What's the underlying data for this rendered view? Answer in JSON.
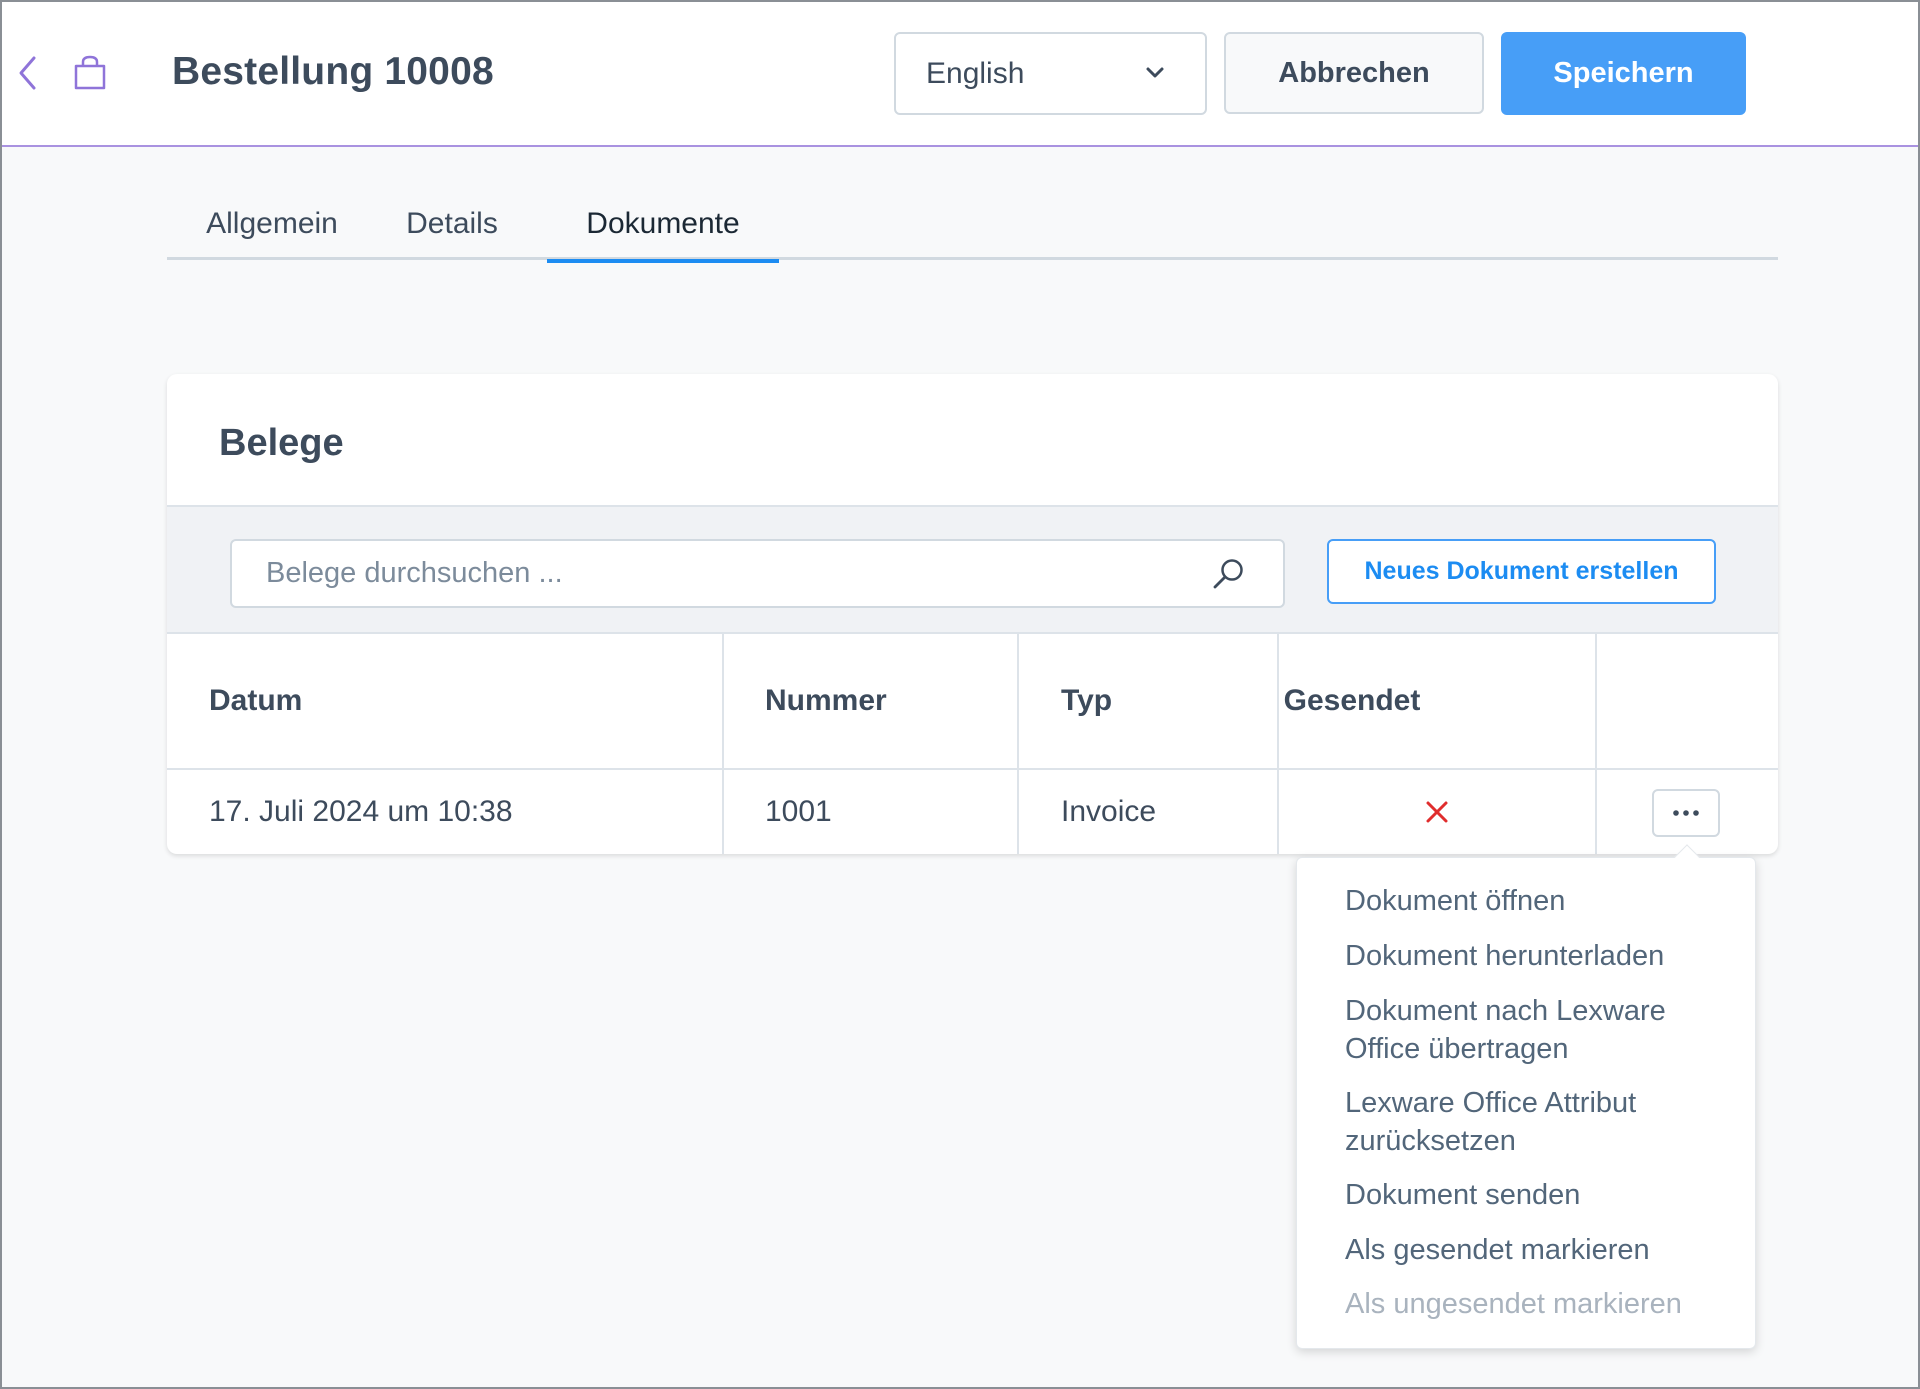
{
  "header": {
    "title": "Bestellung 10008",
    "language": "English",
    "cancel_label": "Abbrechen",
    "save_label": "Speichern"
  },
  "tabs": [
    {
      "label": "Allgemein",
      "active": false
    },
    {
      "label": "Details",
      "active": false
    },
    {
      "label": "Dokumente",
      "active": true
    }
  ],
  "card": {
    "title": "Belege",
    "search_placeholder": "Belege durchsuchen ...",
    "new_button_label": "Neues Dokument erstellen",
    "columns": [
      "Datum",
      "Nummer",
      "Typ",
      "Gesendet"
    ],
    "rows": [
      {
        "datum": "17. Juli 2024 um 10:38",
        "nummer": "1001",
        "typ": "Invoice",
        "gesendet": false
      }
    ]
  },
  "context_menu": {
    "items": [
      {
        "label": "Dokument öffnen",
        "enabled": true
      },
      {
        "label": "Dokument herunterladen",
        "enabled": true
      },
      {
        "label": "Dokument nach Lexware Office übertragen",
        "enabled": true
      },
      {
        "label": "Lexware Office Attribut zurücksetzen",
        "enabled": true
      },
      {
        "label": "Dokument senden",
        "enabled": true
      },
      {
        "label": "Als gesendet markieren",
        "enabled": true
      },
      {
        "label": "Als ungesendet markieren",
        "enabled": false
      }
    ]
  },
  "colors": {
    "primary": "#479ef7",
    "accent_line": "#a992e0",
    "text_dark": "#3d4b5c",
    "not_sent": "#e02d2d"
  }
}
